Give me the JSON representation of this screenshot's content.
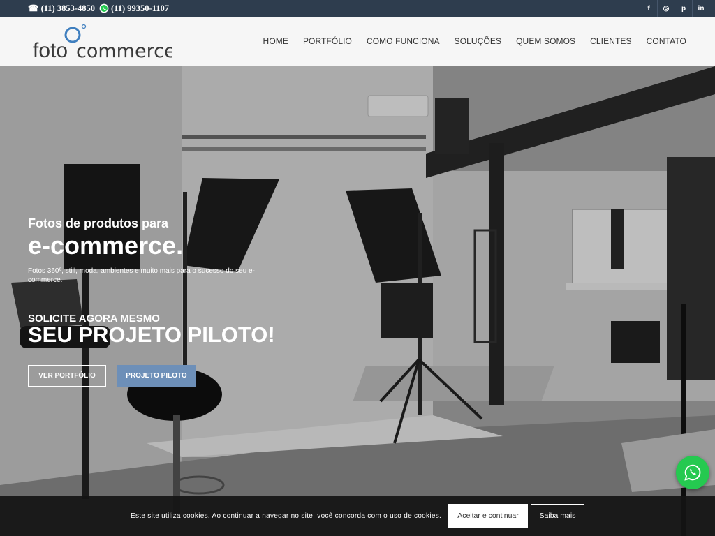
{
  "topbar": {
    "phone": "(11) 3853-4850",
    "whatsapp": "(11) 99350-1107",
    "social": [
      {
        "icon": "facebook-icon",
        "glyph": "f"
      },
      {
        "icon": "instagram-icon",
        "glyph": "◎"
      },
      {
        "icon": "pinterest-icon",
        "glyph": "p"
      },
      {
        "icon": "linkedin-icon",
        "glyph": "in"
      }
    ]
  },
  "logo": {
    "word1": "foto",
    "word2": "commerce"
  },
  "nav": [
    {
      "label": "HOME",
      "active": true
    },
    {
      "label": "PORTFÓLIO",
      "active": false
    },
    {
      "label": "COMO FUNCIONA",
      "active": false
    },
    {
      "label": "SOLUÇÕES",
      "active": false
    },
    {
      "label": "QUEM SOMOS",
      "active": false
    },
    {
      "label": "CLIENTES",
      "active": false
    },
    {
      "label": "CONTATO",
      "active": false
    }
  ],
  "hero": {
    "subtitle": "Fotos de produtos para",
    "title": "e-commerce.",
    "description": "Fotos 360º, still, moda, ambientes e muito mais para o sucesso do seu e-commerce.",
    "cta_small": "SOLICITE AGORA MESMO",
    "cta_big": "SEU PROJETO PILOTO!",
    "btn_portfolio": "VER PORTFÓLIO",
    "btn_pilot": "PROJETO PILOTO"
  },
  "cookie": {
    "message": "Este site utiliza cookies. Ao continuar a navegar no site, você concorda com o uso de cookies.",
    "accept": "Aceitar e continuar",
    "more": "Saiba mais"
  },
  "colors": {
    "topbar": "#2e3d4e",
    "accent": "#7ea6cf",
    "button": "#6d8fb8",
    "whatsapp": "#25c950"
  }
}
